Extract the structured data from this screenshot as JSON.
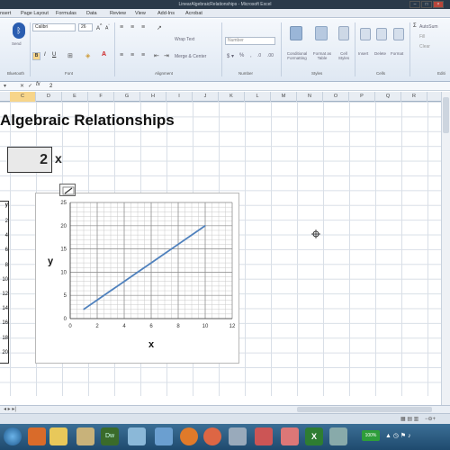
{
  "window": {
    "title": "LinearAlgebraicRelationships - Microsoft Excel"
  },
  "menu_tabs": [
    "nsert",
    "Page Layout",
    "Formulas",
    "Data",
    "Review",
    "View",
    "Add-Ins",
    "Acrobat"
  ],
  "ribbon": {
    "bluetooth_label": "Send",
    "bluetooth_group": "Bluetooth",
    "font_name": "Calibri",
    "font_size": "26",
    "font_group": "Font",
    "alignment_group": "Alignment",
    "wrap_text": "Wrap Text",
    "merge_center": "Merge & Center",
    "number_format": "Number",
    "number_group": "Number",
    "conditional_formatting": "Conditional Formatting",
    "format_as_table": "Format as Table",
    "cell_styles": "Cell Styles",
    "styles_group": "Styles",
    "insert": "Insert",
    "delete": "Delete",
    "format": "Format",
    "cells_group": "Cells",
    "autosum": "AutoSum",
    "fill": "Fill",
    "clear": "Clear",
    "editing_group": "Editi"
  },
  "formula_bar": {
    "fx": "fx",
    "value": "2"
  },
  "columns": [
    "C",
    "D",
    "E",
    "F",
    "G",
    "H",
    "I",
    "J",
    "K",
    "L",
    "M",
    "N",
    "O",
    "P",
    "Q",
    "R"
  ],
  "sheet": {
    "heading": "Algebraic Relationships",
    "x_value": "2",
    "x_label": "x",
    "y_header": "y",
    "y_values": [
      "2",
      "4",
      "6",
      "8",
      "10",
      "12",
      "14",
      "16",
      "18",
      "20"
    ]
  },
  "chart_data": {
    "type": "line",
    "xlabel": "x",
    "ylabel": "y",
    "xlim": [
      0,
      12
    ],
    "ylim": [
      0,
      25
    ],
    "x_ticks": [
      0,
      2,
      4,
      6,
      8,
      10,
      12
    ],
    "y_ticks": [
      0,
      5,
      10,
      15,
      20,
      25
    ],
    "grid": true,
    "series": [
      {
        "x": [
          1,
          2,
          3,
          4,
          5,
          6,
          7,
          8,
          9,
          10
        ],
        "y": [
          2,
          4,
          6,
          8,
          10,
          12,
          14,
          16,
          18,
          20
        ],
        "color": "#4f81bd"
      }
    ]
  },
  "status": {
    "zoom": "100%"
  },
  "taskbar": {
    "icons": [
      "windows-start",
      "ie",
      "firefox-old",
      "folder",
      "dreamweaver",
      "media",
      "firefox",
      "chrome",
      "paint",
      "app",
      "office",
      "excel",
      "other"
    ],
    "colors": {
      "accent": "#4f81bd",
      "taskbar": "#1f4a6e"
    }
  }
}
